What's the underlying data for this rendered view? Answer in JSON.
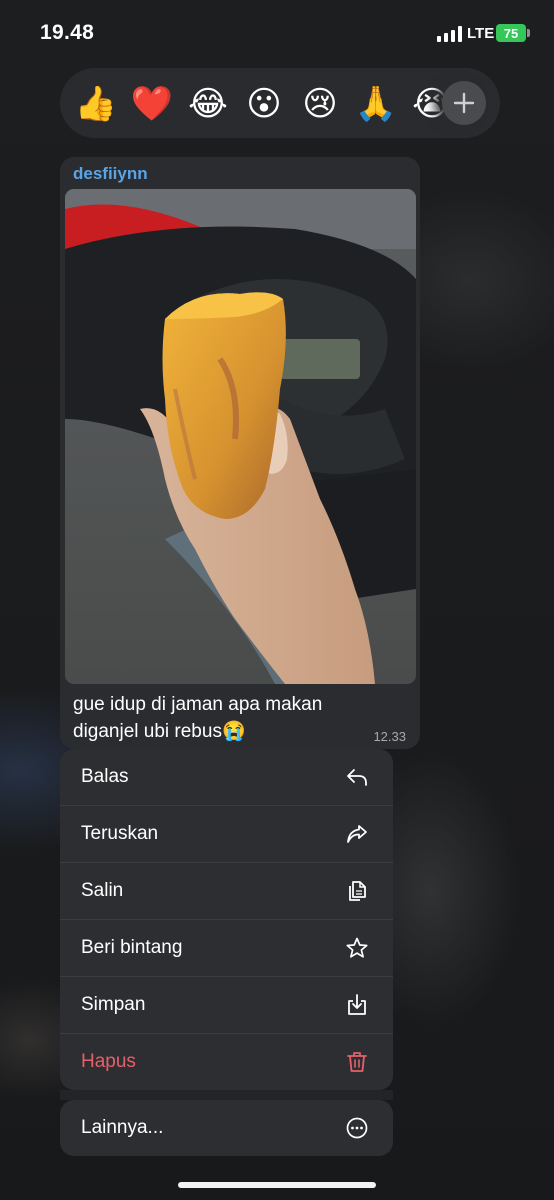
{
  "status_bar": {
    "time": "19.48",
    "network": "LTE",
    "battery": "75",
    "battery_color": "#35c759"
  },
  "reactions": [
    {
      "emoji": "👍",
      "name": "thumbs-up"
    },
    {
      "emoji": "❤️",
      "name": "red-heart"
    },
    {
      "emoji": "😂",
      "name": "tears-of-joy"
    },
    {
      "emoji": "😮",
      "name": "surprised"
    },
    {
      "emoji": "😢",
      "name": "crying"
    },
    {
      "emoji": "🙏",
      "name": "folded-hands"
    },
    {
      "emoji": "😭",
      "name": "loudly-crying"
    }
  ],
  "message": {
    "sender": "desfiiynn",
    "caption": "gue idup di jaman apa makan diganjel ubi rebus😭",
    "time": "12.33",
    "sender_color": "#5aa4e6"
  },
  "menu": {
    "items": [
      {
        "label": "Balas",
        "icon": "reply-icon"
      },
      {
        "label": "Teruskan",
        "icon": "forward-icon"
      },
      {
        "label": "Salin",
        "icon": "copy-icon"
      },
      {
        "label": "Beri bintang",
        "icon": "star-icon"
      },
      {
        "label": "Simpan",
        "icon": "save-icon"
      },
      {
        "label": "Hapus",
        "icon": "trash-icon",
        "danger": true
      }
    ],
    "more": {
      "label": "Lainnya...",
      "icon": "more-icon"
    },
    "danger_color": "#e5606a"
  }
}
